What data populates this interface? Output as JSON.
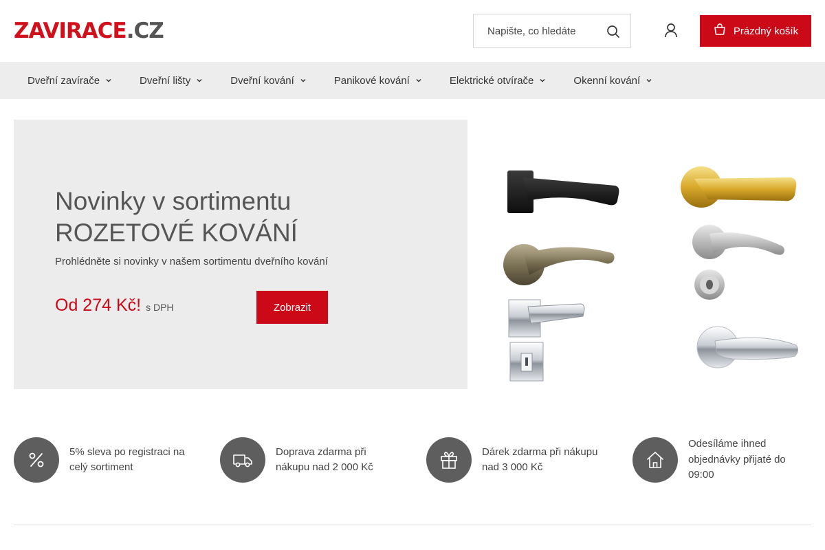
{
  "header": {
    "logo_main": "ZAVIRACE",
    "logo_dot": ".",
    "logo_tld": "CZ",
    "search_placeholder": "Napište, co hledáte",
    "cart_label": "Prázdný košík",
    "brand_color": "#cc0a17"
  },
  "nav": {
    "items": [
      {
        "label": "Dveřní zavírače"
      },
      {
        "label": "Dveřní lišty"
      },
      {
        "label": "Dveřní kování"
      },
      {
        "label": "Panikové kování"
      },
      {
        "label": "Elektrické otvírače"
      },
      {
        "label": "Okenní kování"
      }
    ]
  },
  "hero": {
    "title_line1": "Novinky v sortimentu",
    "title_line2": "ROZETOVÉ KOVÁNÍ",
    "subtitle": "Prohlédněte si novinky v našem sortimentu dveřního kování",
    "price": "Od 274 Kč!",
    "vat_note": "s DPH",
    "button_label": "Zobrazit"
  },
  "usps": [
    {
      "icon": "percent-icon",
      "text": "5% sleva po registraci na celý sortiment"
    },
    {
      "icon": "truck-icon",
      "text": "Doprava zdarma při nákupu nad 2 000 Kč"
    },
    {
      "icon": "gift-icon",
      "text": "Dárek zdarma při nákupu nad 3 000 Kč"
    },
    {
      "icon": "home-icon",
      "text": "Odesíláme ihned objednávky přijaté do 09:00"
    }
  ]
}
